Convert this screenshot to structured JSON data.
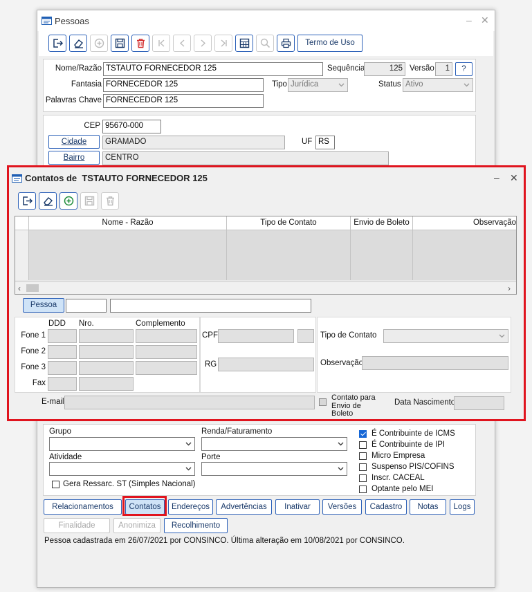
{
  "main_window": {
    "title": "Pessoas",
    "toolbar": {
      "termo_uso": "Termo de Uso"
    },
    "form": {
      "nome_razao_label": "Nome/Razão",
      "nome_razao_value": "TSTAUTO FORNECEDOR 125",
      "sequencia_label": "Sequência",
      "sequencia_value": "125",
      "versao_label": "Versão",
      "versao_value": "1",
      "help_button": "?",
      "fantasia_label": "Fantasia",
      "fantasia_value": "FORNECEDOR 125",
      "tipo_label": "Tipo",
      "tipo_value": "Jurídica",
      "status_label": "Status",
      "status_value": "Ativo",
      "palavras_label": "Palavras Chave",
      "palavras_value": "FORNECEDOR 125"
    },
    "address": {
      "cep_label": "CEP",
      "cep_value": "95670-000",
      "cidade_button": "Cidade",
      "cidade_value": "GRAMADO",
      "uf_label": "UF",
      "uf_value": "RS",
      "bairro_button": "Bairro",
      "bairro_value": "CENTRO"
    },
    "lower": {
      "grupo_label": "Grupo",
      "renda_label": "Renda/Faturamento",
      "atividade_label": "Atividade",
      "porte_label": "Porte",
      "gera_ressarc": "Gera Ressarc. ST (Simples Nacional)",
      "checks": [
        {
          "label": "É Contribuinte de ICMS",
          "checked": true
        },
        {
          "label": "É Contribuinte de IPI",
          "checked": false
        },
        {
          "label": "Micro Empresa",
          "checked": false
        },
        {
          "label": "Suspenso PIS/COFINS",
          "checked": false
        },
        {
          "label": "Inscr. CACEAL",
          "checked": false
        },
        {
          "label": "Optante pelo MEI",
          "checked": false
        }
      ]
    },
    "bottom_buttons": {
      "relacionamentos": "Relacionamentos",
      "contatos": "Contatos",
      "enderecos": "Endereços",
      "advertencias": "Advertências",
      "inativar": "Inativar",
      "versoes": "Versões",
      "cadastro": "Cadastro",
      "notas": "Notas",
      "logs": "Logs",
      "finalidade": "Finalidade",
      "anonimiza": "Anonimiza",
      "recolhimento": "Recolhimento"
    },
    "status_text": "Pessoa cadastrada em 26/07/2021 por CONSINCO. Última alteração em 10/08/2021 por CONSINCO."
  },
  "contacts_dialog": {
    "title": "Contatos de  TSTAUTO FORNECEDOR 125",
    "grid_columns": [
      "Nome - Razão",
      "Tipo de Contato",
      "Envio de Boleto",
      "Observação"
    ],
    "pessoa_button": "Pessoa",
    "ddd_label": "DDD",
    "nro_label": "Nro.",
    "complemento_label": "Complemento",
    "fone1": "Fone 1",
    "fone2": "Fone 2",
    "fone3": "Fone 3",
    "fax": "Fax",
    "cpf_label": "CPF",
    "rg_label": "RG",
    "tipo_contato_label": "Tipo de Contato",
    "observacao_label": "Observação",
    "email_label": "E-mail",
    "contato_boleto": "Contato para Envio de Boleto",
    "data_nascimento_label": "Data Nascimento"
  },
  "colors": {
    "accent_border": "#2b60b8",
    "highlight_red": "#e0141e",
    "check_blue": "#1566d6",
    "delete_red": "#d32f2f",
    "add_green": "#1e8c3a"
  }
}
